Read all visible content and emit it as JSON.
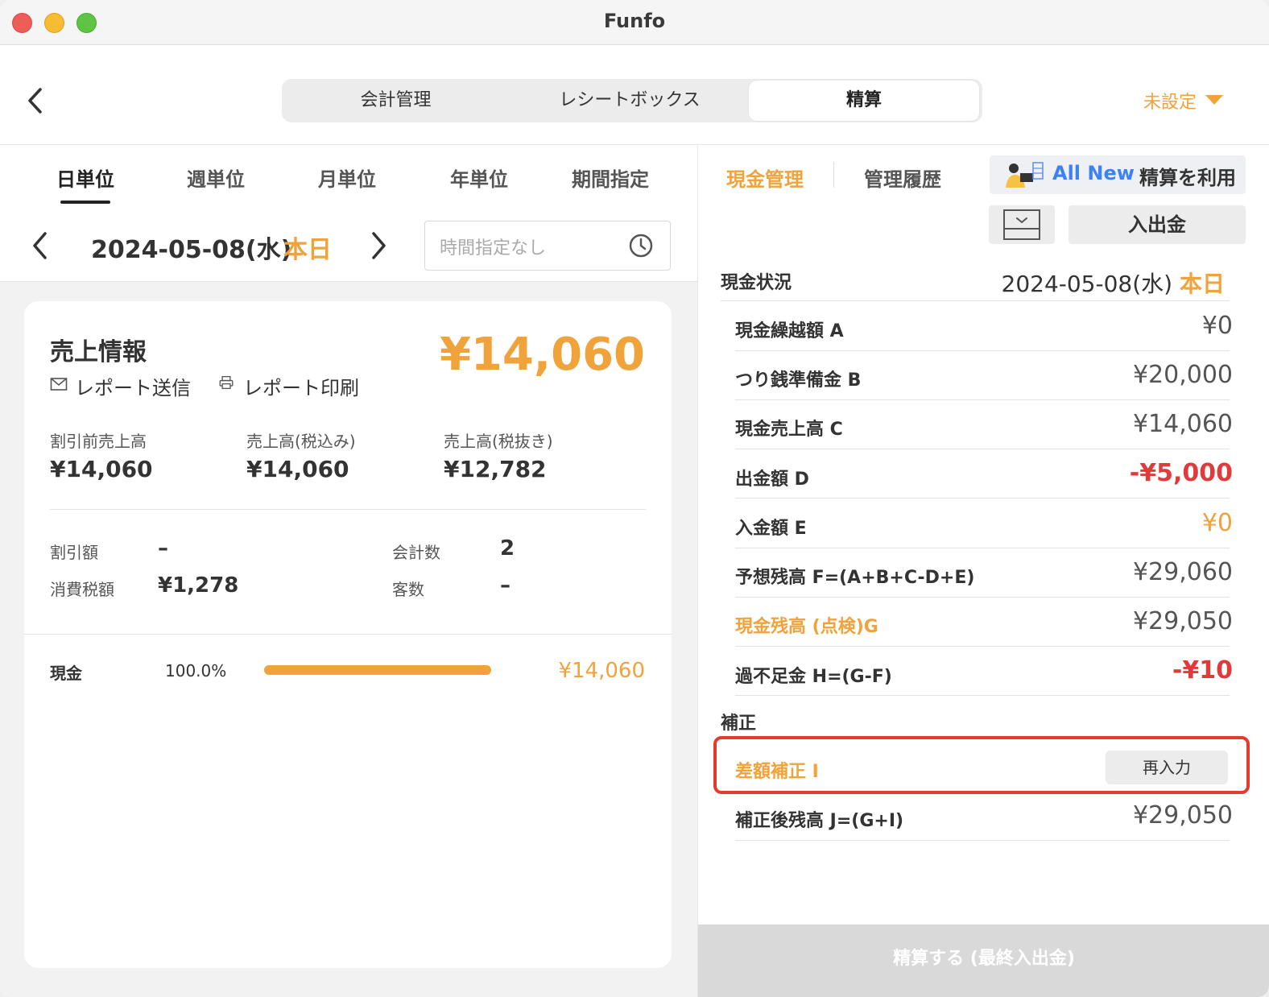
{
  "window": {
    "title": "Funfo"
  },
  "header": {
    "tabs": [
      {
        "label": "会計管理"
      },
      {
        "label": "レシートボックス"
      },
      {
        "label": "精算"
      }
    ],
    "unset_label": "未設定"
  },
  "left": {
    "period_tabs": [
      {
        "label": "日単位"
      },
      {
        "label": "週単位"
      },
      {
        "label": "月単位"
      },
      {
        "label": "年単位"
      },
      {
        "label": "期間指定"
      }
    ],
    "date": "2024-05-08(水)",
    "today_label": "本日",
    "time_placeholder": "時間指定なし",
    "sales": {
      "title": "売上情報",
      "total": "¥14,060",
      "send_report": "レポート送信",
      "print_report": "レポート印刷",
      "stats": [
        {
          "label": "割引前売上高",
          "value": "¥14,060"
        },
        {
          "label": "売上高(税込み)",
          "value": "¥14,060"
        },
        {
          "label": "売上高(税抜き)",
          "value": "¥12,782"
        }
      ],
      "discount_label": "割引額",
      "discount_value": "–",
      "tax_label": "消費税額",
      "tax_value": "¥1,278",
      "count_label": "会計数",
      "count_value": "2",
      "customers_label": "客数",
      "customers_value": "–",
      "payment": {
        "label": "現金",
        "percent": "100.0%",
        "amount": "¥14,060",
        "share": 1.0
      }
    }
  },
  "right": {
    "tab_active": "現金管理",
    "tab_inactive": "管理履歴",
    "promo_new": "All New",
    "promo_text": "精算を利用",
    "inout_label": "入出金",
    "status_title": "現金状況",
    "status_date": "2024-05-08(水)",
    "status_today": "本日",
    "rows": [
      {
        "label": "現金繰越額 A",
        "value": "¥0"
      },
      {
        "label": "つり銭準備金 B",
        "value": "¥20,000"
      },
      {
        "label": "現金売上高 C",
        "value": "¥14,060"
      },
      {
        "label": "出金額 D",
        "value": "-¥5,000"
      },
      {
        "label": "入金額 E",
        "value": "¥0"
      },
      {
        "label": "予想残高 F=(A+B+C-D+E)",
        "value": "¥29,060"
      },
      {
        "label": "現金残高 (点検)G",
        "value": "¥29,050"
      },
      {
        "label": "過不足金 H=(G-F)",
        "value": "-¥10"
      }
    ],
    "correction_title": "補正",
    "correction_label": "差額補正 I",
    "reinput_label": "再入力",
    "after_label": "補正後残高 J=(G+I)",
    "after_value": "¥29,050",
    "settle_label": "精算する (最終入出金)"
  }
}
